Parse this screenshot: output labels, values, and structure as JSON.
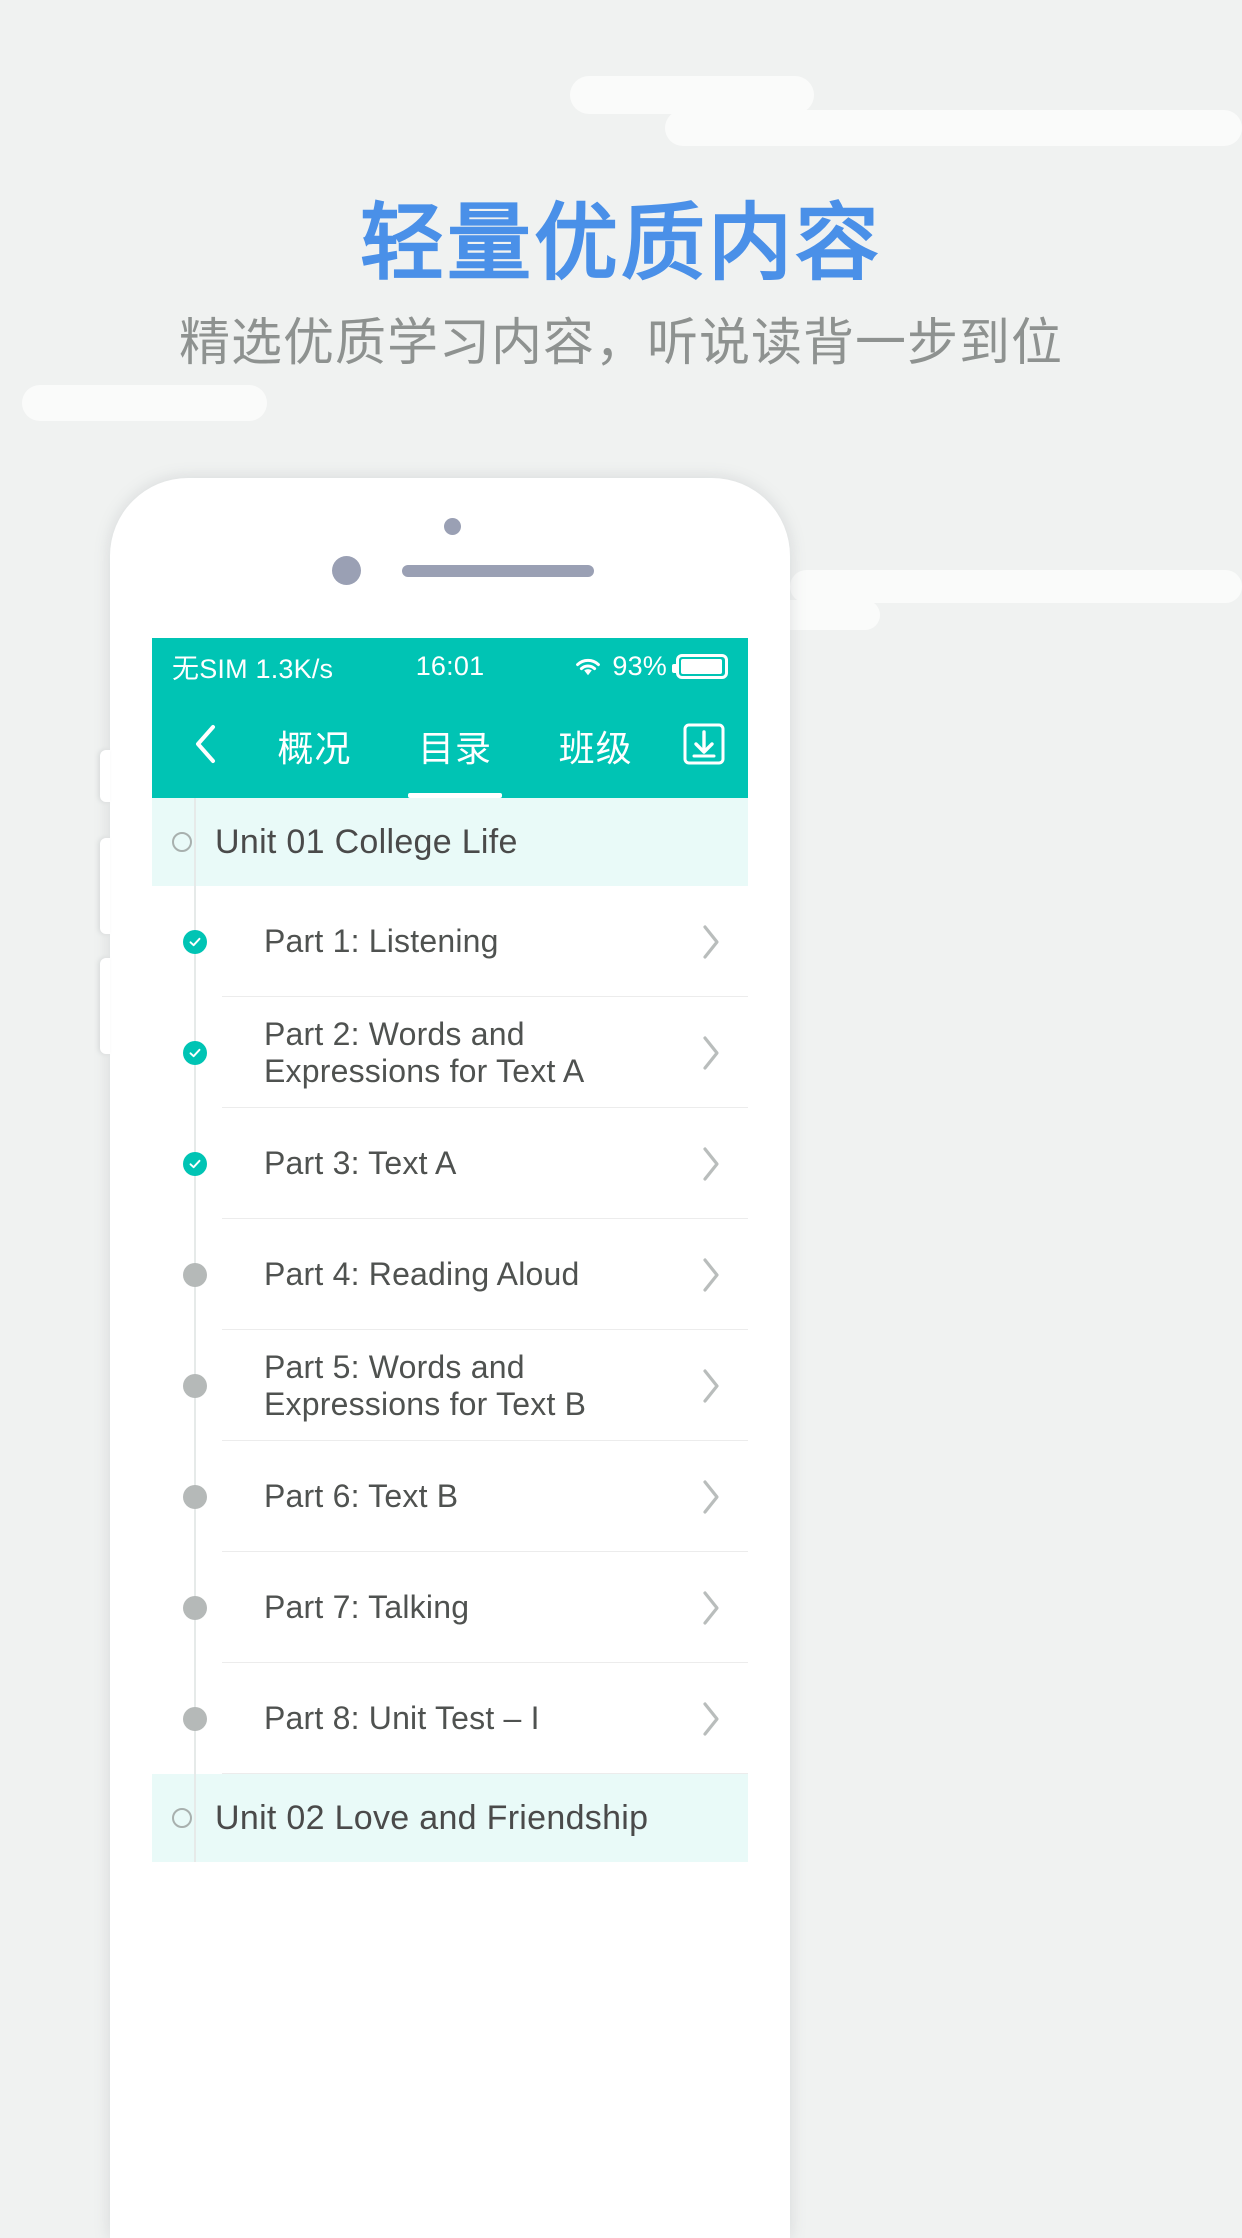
{
  "promo": {
    "headline": "轻量优质内容",
    "subhead": "精选优质学习内容，听说读背一步到位",
    "headline_color": "#4a90e8",
    "subhead_color": "#8e9290",
    "background_color": "#f0f2f1"
  },
  "phone": {
    "accent_color": "#00c4b4",
    "statusbar": {
      "carrier": "无SIM 1.3K/s",
      "time": "16:01",
      "wifi_icon": "wifi-icon",
      "battery_percent": "93%",
      "battery_icon": "battery-icon"
    },
    "navbar": {
      "back_icon": "chevron-left-icon",
      "download_icon": "download-icon",
      "tabs": [
        {
          "label": "概况",
          "active": false
        },
        {
          "label": "目录",
          "active": true
        },
        {
          "label": "班级",
          "active": false
        }
      ]
    },
    "list": [
      {
        "type": "unit",
        "label": "Unit 01 College Life",
        "marker": "circle-outline"
      },
      {
        "type": "part",
        "label": "Part 1: Listening",
        "status": "done"
      },
      {
        "type": "part",
        "label": "Part 2: Words and Expressions for Text A",
        "status": "done"
      },
      {
        "type": "part",
        "label": "Part 3: Text A",
        "status": "done"
      },
      {
        "type": "part",
        "label": "Part 4: Reading Aloud",
        "status": "todo"
      },
      {
        "type": "part",
        "label": "Part 5: Words and Expressions for Text B",
        "status": "todo"
      },
      {
        "type": "part",
        "label": "Part 6: Text B",
        "status": "todo"
      },
      {
        "type": "part",
        "label": "Part 7: Talking",
        "status": "todo"
      },
      {
        "type": "part",
        "label": "Part 8: Unit Test – I",
        "status": "todo"
      },
      {
        "type": "unit",
        "label": "Unit 02 Love and Friendship",
        "marker": "circle-outline"
      }
    ]
  }
}
